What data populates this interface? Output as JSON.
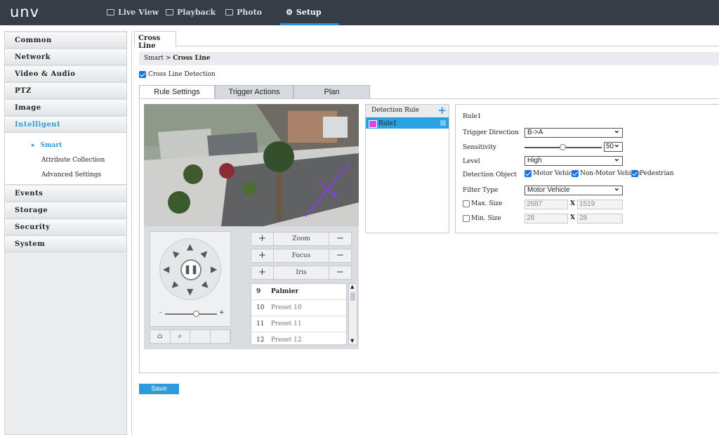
{
  "app": {
    "logo": "unv"
  },
  "nav": [
    {
      "label": "Live View",
      "icon": "monitor-icon"
    },
    {
      "label": "Playback",
      "icon": "film-icon"
    },
    {
      "label": "Photo",
      "icon": "photo-icon"
    },
    {
      "label": "Setup",
      "icon": "gear-icon"
    }
  ],
  "sidebar": {
    "items": [
      "Common",
      "Network",
      "Video & Audio",
      "PTZ",
      "Image",
      "Intelligent",
      "Events",
      "Storage",
      "Security",
      "System"
    ],
    "sub": [
      "Smart",
      "Attribute Collection",
      "Advanced Settings"
    ]
  },
  "page": {
    "tab": "Cross Line",
    "breadcrumb_root": "Smart",
    "breadcrumb_sep": ">",
    "breadcrumb_current": "Cross Line",
    "detection_label": "Cross Line Detection",
    "detection_checked": true
  },
  "tabs": [
    "Rule Settings",
    "Trigger Actions",
    "Plan"
  ],
  "ptz": {
    "zoom_label": "Zoom",
    "focus_label": "Focus",
    "iris_label": "Iris",
    "speed_minus": "-",
    "speed_plus": "+",
    "speed_level": 0.6,
    "presets": [
      {
        "num": "9",
        "name": "Palmier"
      },
      {
        "num": "10",
        "name": "Preset 10"
      },
      {
        "num": "11",
        "name": "Preset 11"
      },
      {
        "num": "12",
        "name": "Preset 12"
      }
    ]
  },
  "rules": {
    "header": "Detection Rule",
    "items": [
      "Rule1"
    ],
    "swatch_color": "#d946ef"
  },
  "rule_settings": {
    "title": "Rule1",
    "trigger_direction_label": "Trigger Direction",
    "trigger_direction_value": "B->A",
    "sensitivity_label": "Sensitivity",
    "sensitivity_value": "50",
    "level_label": "Level",
    "level_value": "High",
    "detection_object_label": "Detection Object",
    "objects": [
      "Motor Vehicle",
      "Non-Motor Vehicle",
      "Pedestrian"
    ],
    "filter_type_label": "Filter Type",
    "filter_type_value": "Motor Vehicle",
    "max_size_label": "Max. Size",
    "max_w": "2687",
    "max_h": "1519",
    "min_size_label": "Min. Size",
    "min_w": "28",
    "min_h": "28",
    "x_sep": "X"
  },
  "save_label": "Save",
  "colors": {
    "accent": "#2b9bd9",
    "topbar": "#373d47"
  }
}
